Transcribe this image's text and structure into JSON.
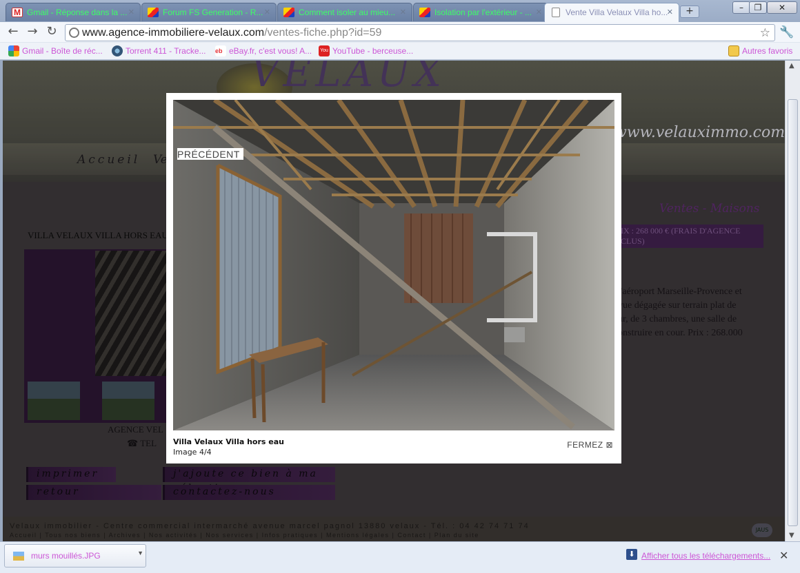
{
  "tabs": [
    {
      "title": "Gmail - Réponse dans la ...",
      "icon": "gmail-icon"
    },
    {
      "title": "Forum FS Generation - R...",
      "icon": "fs-generation-icon"
    },
    {
      "title": "Comment isoler au mieu...",
      "icon": "fs-generation-icon"
    },
    {
      "title": "Isolation par l'extérieur - ...",
      "icon": "fs-generation-icon"
    },
    {
      "title": "Vente Villa Velaux Villa ho...",
      "icon": "document-icon",
      "active": true
    }
  ],
  "toolbar": {
    "url_host": "www.agence-immobiliere-velaux.com",
    "url_path": "/ventes-fiche.php?id=59"
  },
  "bookmarks": [
    {
      "label": "Gmail - Boîte de réc...",
      "icon": "google-icon"
    },
    {
      "label": "Torrent 411 - Tracke...",
      "icon": "torrent-icon"
    },
    {
      "label": "eBay.fr, c'est vous! A...",
      "icon": "ebay-icon"
    },
    {
      "label": "YouTube - berceuse...",
      "icon": "youtube-icon"
    }
  ],
  "other_bookmarks": "Autres favoris",
  "site": {
    "logo": "VELAUX",
    "url": "www.velauximmo.com",
    "nav": {
      "accueil": "Accueil",
      "ventes": "Ve"
    },
    "category": "Ventes - Maisons",
    "listing_title": "VILLA VELAUX VILLA HORS EAU",
    "price_line1": "IX : 268 000 € (FRAIS D'AGENCE",
    "price_line2": "CLUS)",
    "desc_lines": [
      "l'aéroport Marseille-Provence et",
      "vue dégagée sur terrain plat de",
      "ur, de 3 chambres, une salle de",
      "onstruire en cour. Prix : 268.000"
    ],
    "agency": "AGENCE VEL",
    "tel": "TEL",
    "actions": {
      "imprimer": "imprimer",
      "selection": "j'ajoute ce bien à ma sélection",
      "retour": "retour",
      "contact": "contactez-nous"
    },
    "footer_line1": "Velaux immobilier - Centre commercial intermarché avenue marcel pagnol 13880 velaux - Tél. : 04 42 74 71 74",
    "footer_line2": "Accueil | Tous nos biens | Archives | Nos activités | Nos services | Infos pratiques | Mentions légales | Contact | Plan du site",
    "footer_badge": "JAUS"
  },
  "lightbox": {
    "prev": "PRÉCÉDENT",
    "caption": "Villa Velaux Villa hors eau",
    "counter": "Image 4/4",
    "close": "FERMEZ ⊠"
  },
  "downloads": {
    "file": "murs mouillés.JPG",
    "show_all": "Afficher tous les téléchargements..."
  }
}
